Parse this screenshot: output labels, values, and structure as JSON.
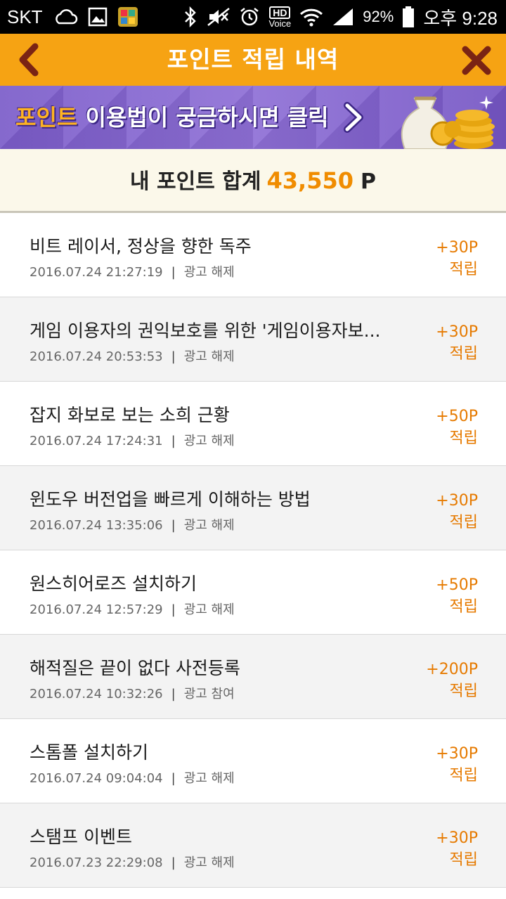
{
  "status_bar": {
    "carrier": "SKT",
    "hd_label": "HD",
    "voice_label": "Voice",
    "battery": "92%",
    "time": "오후 9:28",
    "icons": [
      "cloud-icon",
      "gallery-icon",
      "app-icon",
      "bluetooth-icon",
      "mute-icon",
      "alarm-icon",
      "wifi-icon",
      "signal-icon",
      "battery-icon"
    ]
  },
  "header": {
    "title": "포인트 적립 내역",
    "back_icon": "chevron-left-icon",
    "close_icon": "close-icon"
  },
  "banner": {
    "highlight": "포인트",
    "text": " 이용법이 궁금하시면 클릭",
    "arrow_icon": "chevron-right-icon",
    "image": "money-bag-icon"
  },
  "total": {
    "label": "내 포인트 합계",
    "amount": "43,550",
    "unit": "P"
  },
  "colors": {
    "header": "#f6a313",
    "accent": "#f08c00",
    "banner": "#7b5cc9"
  },
  "history": [
    {
      "title": "비트 레이서, 정상을 향한 독주",
      "datetime": "2016.07.24 21:27:19",
      "type": "광고 해제",
      "points": "+30P",
      "status": "적립"
    },
    {
      "title": "게임 이용자의 권익보호를 위한 '게임이용자보...",
      "datetime": "2016.07.24 20:53:53",
      "type": "광고 해제",
      "points": "+30P",
      "status": "적립"
    },
    {
      "title": "잡지 화보로 보는 소희 근황",
      "datetime": "2016.07.24 17:24:31",
      "type": "광고 해제",
      "points": "+50P",
      "status": "적립"
    },
    {
      "title": "윈도우 버전업을 빠르게 이해하는 방법",
      "datetime": "2016.07.24 13:35:06",
      "type": "광고 해제",
      "points": "+30P",
      "status": "적립"
    },
    {
      "title": "원스히어로즈 설치하기",
      "datetime": "2016.07.24 12:57:29",
      "type": "광고 해제",
      "points": "+50P",
      "status": "적립"
    },
    {
      "title": "해적질은 끝이 없다 사전등록",
      "datetime": "2016.07.24 10:32:26",
      "type": "광고 참여",
      "points": "+200P",
      "status": "적립"
    },
    {
      "title": "스톰폴 설치하기",
      "datetime": "2016.07.24 09:04:04",
      "type": "광고 해제",
      "points": "+30P",
      "status": "적립"
    },
    {
      "title": "스탬프 이벤트",
      "datetime": "2016.07.23 22:29:08",
      "type": "광고 해제",
      "points": "+30P",
      "status": "적립"
    }
  ]
}
